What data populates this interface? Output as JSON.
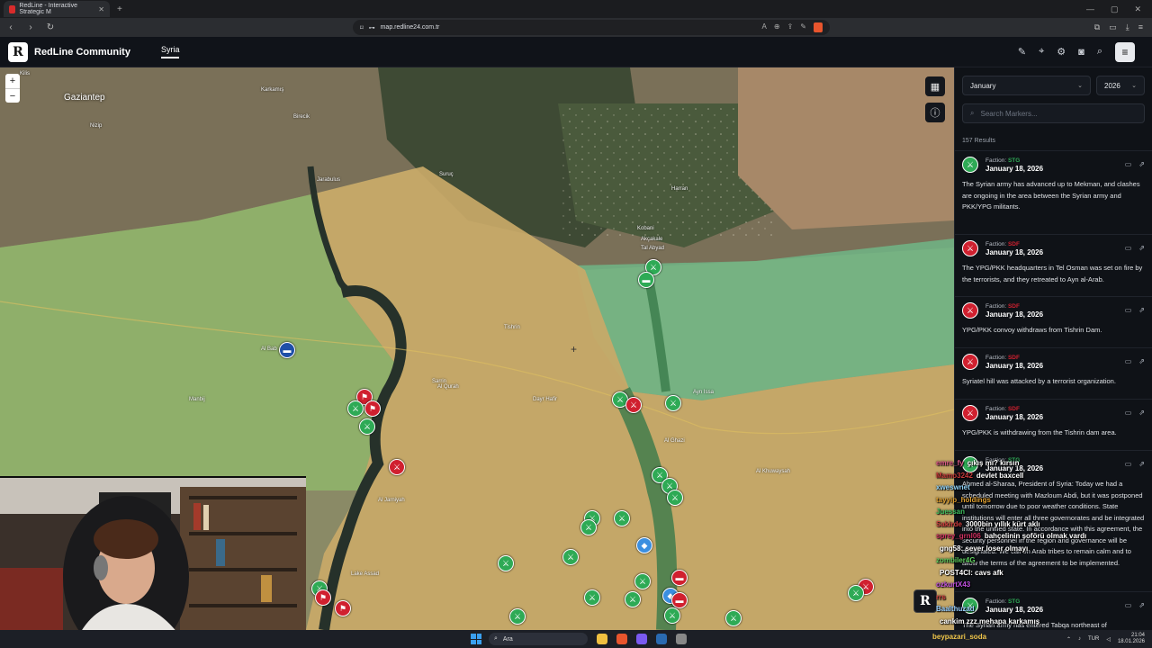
{
  "browser": {
    "tab_title": "RedLine - Interactive Strategic M",
    "tab_close": "✕",
    "new_tab": "+",
    "url": "map.redline24.com.tr",
    "window_controls": [
      "—",
      "▢",
      "✕"
    ]
  },
  "header": {
    "logo_letter": "R",
    "brand": "RedLine Community",
    "active_tab": "Syria",
    "icons": [
      "pen-icon",
      "pin-icon",
      "gear-icon",
      "camera-icon",
      "search-icon",
      "menu-icon"
    ]
  },
  "map": {
    "zoom_in": "+",
    "zoom_out": "−",
    "cities": [
      {
        "name": "Gaziantep"
      }
    ],
    "labels": [
      "Kilis",
      "Karkamış",
      "Jarabulus",
      "Suruç",
      "Kobani",
      "Al Bab",
      "Manbij",
      "Tishrin",
      "Lake Assad",
      "Dayr Hafir",
      "Al Ghazi",
      "Al Khuwaysah",
      "Ayn Issa",
      "Tal Abyad",
      "Harran",
      "Akçakale",
      "Birecik",
      "Nizip",
      "Sarrin",
      "Al Jarniyah",
      "Al Qurah"
    ]
  },
  "panel": {
    "month": "January",
    "year": "2026",
    "search_placeholder": "Search Markers...",
    "results": "157 Results",
    "faction_prefix": "Faction:",
    "cards": [
      {
        "faction": "STG",
        "faction_color": "#2eaa55",
        "icon_bg": "#2eaa55",
        "date": "January 18, 2026",
        "text": "The Syrian army has advanced up to Mekman, and clashes are ongoing in the area between the Syrian army and PKK/YPG militants."
      },
      {
        "faction": "SDF",
        "faction_color": "#d0202f",
        "icon_bg": "#d0202f",
        "date": "January 18, 2026",
        "text": "The YPG/PKK headquarters in Tel Osman was set on fire by the terrorists, and they retreated to Ayn al-Arab."
      },
      {
        "faction": "SDF",
        "faction_color": "#d0202f",
        "icon_bg": "#d0202f",
        "date": "January 18, 2026",
        "text": "YPG/PKK convoy withdraws from Tishrin Dam."
      },
      {
        "faction": "SDF",
        "faction_color": "#d0202f",
        "icon_bg": "#d0202f",
        "date": "January 18, 2026",
        "text": "Syriatel hill was attacked by a terrorist organization."
      },
      {
        "faction": "SDF",
        "faction_color": "#d0202f",
        "icon_bg": "#d0202f",
        "date": "January 18, 2026",
        "text": "YPG/PKK is withdrawing from the Tishrin dam area."
      },
      {
        "faction": "STG",
        "faction_color": "#2eaa55",
        "icon_bg": "#2eaa55",
        "date": "January 18, 2026",
        "text": "Ahmed al-Sharaa, President of Syria: Today we had a scheduled meeting with Mazloum Abdi, but it was postponed until tomorrow due to poor weather conditions. State institutions will enter all three governorates and be integrated into the unified state. In accordance with this agreement, the security personnel in the region and governance will be designated. We call on Arab tribes to remain calm and to allow the terms of the agreement to be implemented."
      },
      {
        "faction": "STG",
        "faction_color": "#2eaa55",
        "icon_bg": "#2eaa55",
        "date": "January 18, 2026",
        "text": "The Syrian army has entered Tabqa northeast of"
      }
    ]
  },
  "chat": [
    {
      "user": "emre_fy",
      "user_color": "#e05a8a",
      "msg": "çıkış mı? kırsın"
    },
    {
      "user": "Mamo3242",
      "user_color": "#c83a3a",
      "msg": "devlet baxcell"
    },
    {
      "user": "xweswnet",
      "user_color": "#8fd0f5",
      "msg": ""
    },
    {
      "user": "tayyip_holdings",
      "user_color": "#e0a030",
      "msg": ""
    },
    {
      "user": "Juessan",
      "user_color": "#40c060",
      "msg": ""
    },
    {
      "user": "Sakirde",
      "user_color": "#d04040",
      "msg": "3000bin yıllık kürt aklı"
    },
    {
      "user": "sprey_grnl06",
      "user_color": "#d03060",
      "msg": "bahçelinin şoförü olmak vardı"
    },
    {
      "user": "",
      "user_color": "#ffffff",
      "msg": "gng58: sever loser olmayı"
    },
    {
      "user": "zombiler4G",
      "user_color": "#60d060",
      "msg": ""
    },
    {
      "user": "",
      "user_color": "#ffffff",
      "msg": "POST4CI: cavs afk"
    },
    {
      "user": "ozkurtX43",
      "user_color": "#c050e0",
      "msg": ""
    },
    {
      "user": "rrs",
      "user_color": "#d04040",
      "msg": ""
    },
    {
      "user": "Baalthuzad",
      "user_color": "#9ad0ff",
      "msg": ""
    },
    {
      "user": "",
      "user_color": "#ffffff",
      "msg": "cankim zzz mehapa karkamış"
    }
  ],
  "taskbar": {
    "ticker": "beypazari_soda",
    "search": "Ara",
    "lang": "TUR",
    "time": "21:04",
    "date": "18.01.2026"
  }
}
